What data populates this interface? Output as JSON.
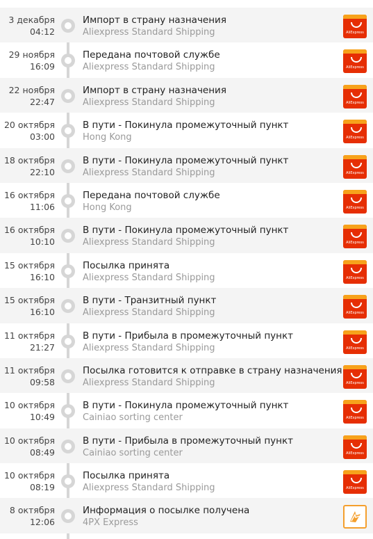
{
  "events": [
    {
      "date": "3 декабря",
      "time": "04:12",
      "status": "Импорт в страну назначения",
      "location": "Aliexpress Standard Shipping",
      "logo": "aliexpress",
      "logo_text": "AliExpress"
    },
    {
      "date": "29 ноября",
      "time": "16:09",
      "status": "Передана почтовой службе",
      "location": "Aliexpress Standard Shipping",
      "logo": "aliexpress",
      "logo_text": "AliExpress"
    },
    {
      "date": "22 ноября",
      "time": "22:47",
      "status": "Импорт в страну назначения",
      "location": "Aliexpress Standard Shipping",
      "logo": "aliexpress",
      "logo_text": "AliExpress"
    },
    {
      "date": "20 октября",
      "time": "03:00",
      "status": "В пути - Покинула промежуточный пункт",
      "location": "Hong Kong",
      "logo": "aliexpress",
      "logo_text": "AliExpress"
    },
    {
      "date": "18 октября",
      "time": "22:10",
      "status": "В пути - Покинула промежуточный пункт",
      "location": "Aliexpress Standard Shipping",
      "logo": "aliexpress",
      "logo_text": "AliExpress"
    },
    {
      "date": "16 октября",
      "time": "11:06",
      "status": "Передана почтовой службе",
      "location": "Hong Kong",
      "logo": "aliexpress",
      "logo_text": "AliExpress"
    },
    {
      "date": "16 октября",
      "time": "10:10",
      "status": "В пути - Покинула промежуточный пункт",
      "location": "Aliexpress Standard Shipping",
      "logo": "aliexpress",
      "logo_text": "AliExpress"
    },
    {
      "date": "15 октября",
      "time": "16:10",
      "status": "Посылка принята",
      "location": "Aliexpress Standard Shipping",
      "logo": "aliexpress",
      "logo_text": "AliExpress"
    },
    {
      "date": "15 октября",
      "time": "16:10",
      "status": "В пути - Транзитный пункт",
      "location": "Aliexpress Standard Shipping",
      "logo": "aliexpress",
      "logo_text": "AliExpress"
    },
    {
      "date": "11 октября",
      "time": "21:27",
      "status": "В пути - Прибыла в промежуточный пункт",
      "location": "Aliexpress Standard Shipping",
      "logo": "aliexpress",
      "logo_text": "AliExpress"
    },
    {
      "date": "11 октября",
      "time": "09:58",
      "status": "Посылка готовится к отправке в страну назначения",
      "location": "Aliexpress Standard Shipping",
      "logo": "aliexpress",
      "logo_text": "AliExpress"
    },
    {
      "date": "10 октября",
      "time": "10:49",
      "status": "В пути - Покинула промежуточный пункт",
      "location": "Cainiao sorting center",
      "logo": "aliexpress",
      "logo_text": "AliExpress"
    },
    {
      "date": "10 октября",
      "time": "08:49",
      "status": "В пути - Прибыла в промежуточный пункт",
      "location": "Cainiao sorting center",
      "logo": "aliexpress",
      "logo_text": "AliExpress"
    },
    {
      "date": "10 октября",
      "time": "08:19",
      "status": "Посылка принята",
      "location": "Aliexpress Standard Shipping",
      "logo": "aliexpress",
      "logo_text": "AliExpress"
    },
    {
      "date": "8 октября",
      "time": "12:06",
      "status": "Информация о посылке получена",
      "location": "4PX Express",
      "logo": "4px",
      "logo_text": ""
    }
  ],
  "colors": {
    "aliexpress_red": "#e62e04",
    "aliexpress_orange": "#f7a21b",
    "fourpx_orange": "#f49f2d",
    "timeline_gray": "#d6d6d6",
    "row_shade": "#f4f4f4"
  }
}
